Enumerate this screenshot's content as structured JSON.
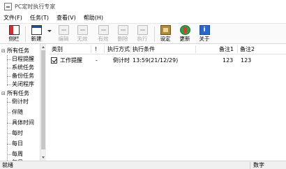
{
  "window": {
    "title": "PC定时执行专家"
  },
  "menu": [
    {
      "label": "文件(F)"
    },
    {
      "label": "任务(T)"
    },
    {
      "label": "查看(V)"
    },
    {
      "label": "帮助(H)"
    }
  ],
  "toolbar": {
    "sidebar": "侧栏",
    "new": "新建",
    "edit": "编辑",
    "disable": "无效",
    "enable": "有效",
    "delete": "删除",
    "execute": "执行",
    "settings": "设定",
    "update": "更新",
    "about": "关于"
  },
  "tree": {
    "group1": {
      "label": "所有任务",
      "children": [
        "日程提醒",
        "系统任务",
        "备份任务",
        "关闭程序"
      ]
    },
    "group2": {
      "label": "所有任务",
      "children": [
        "倒计时",
        "伴随",
        "具体时间",
        "每时",
        "每日",
        "每周",
        "每月"
      ]
    }
  },
  "columns": [
    "类别",
    "!",
    "执行方式",
    "执行条件",
    "备注1",
    "备注2"
  ],
  "rows": [
    {
      "checked": true,
      "category": "工作提醒",
      "priority": "-",
      "method": "倒计时",
      "condition": "13:59(21/12/29)",
      "note1": "123",
      "note2": "123"
    }
  ],
  "status": {
    "left": "就绪",
    "right": "数字"
  }
}
